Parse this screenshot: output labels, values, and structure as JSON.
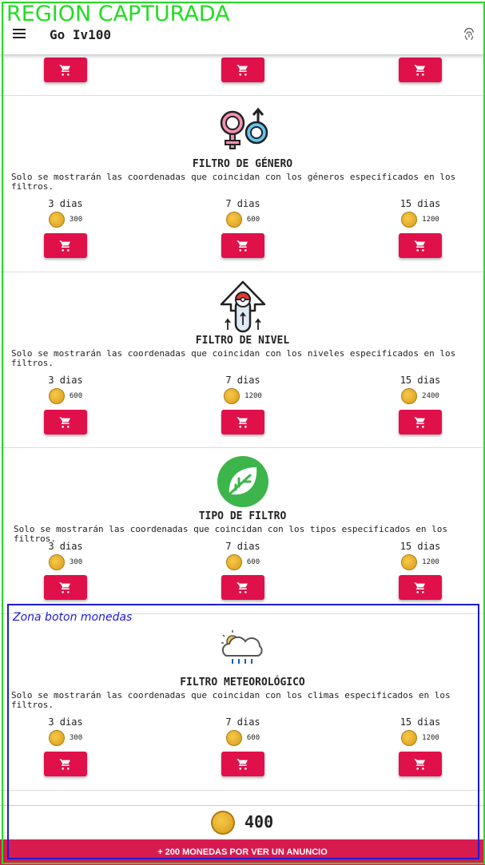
{
  "overlays": {
    "region_label": "REGION CAPTURADA",
    "zone_label": "Zona boton monedas"
  },
  "appbar": {
    "title": "Go Iv100",
    "menu_icon": "menu-icon",
    "fingerprint_icon": "fingerprint-icon"
  },
  "cards": [
    {
      "title": "FILTRO DE GÉNERO",
      "desc": "Solo se mostrarán las coordenadas que coincidan con los géneros especificados en los filtros.",
      "icon": "gender-icon",
      "options": [
        {
          "days": "3 dias",
          "price": "300"
        },
        {
          "days": "7 dias",
          "price": "600"
        },
        {
          "days": "15 dias",
          "price": "1200"
        }
      ]
    },
    {
      "title": "FILTRO DE NIVEL",
      "desc": "Solo se mostrarán las coordenadas que coincidan con los niveles especificados en los filtros.",
      "icon": "level-up-icon",
      "options": [
        {
          "days": "3 dias",
          "price": "600"
        },
        {
          "days": "7 dias",
          "price": "1200"
        },
        {
          "days": "15 dias",
          "price": "2400"
        }
      ]
    },
    {
      "title": "TIPO DE FILTRO",
      "desc": "Solo se mostrarán las coordenadas que coincidan con los tipos especificados en los filtros.",
      "icon": "leaf-icon",
      "options": [
        {
          "days": "3 dias",
          "price": "300"
        },
        {
          "days": "7 dias",
          "price": "600"
        },
        {
          "days": "15 dias",
          "price": "1200"
        }
      ]
    },
    {
      "title": "FILTRO METEOROLÓGICO",
      "desc": "Solo se mostrarán las coordenadas que coincidan con los climas especificados en los filtros.",
      "icon": "weather-icon",
      "options": [
        {
          "days": "3 dias",
          "price": "300"
        },
        {
          "days": "7 dias",
          "price": "600"
        },
        {
          "days": "15 dias",
          "price": "1200"
        }
      ]
    }
  ],
  "bottom": {
    "coins": "400",
    "ad_button": "+ 200 MONEDAS POR VER UN ANUNCIO"
  },
  "colors": {
    "accent": "#e0104a",
    "ad_bar": "#d81b4f"
  }
}
